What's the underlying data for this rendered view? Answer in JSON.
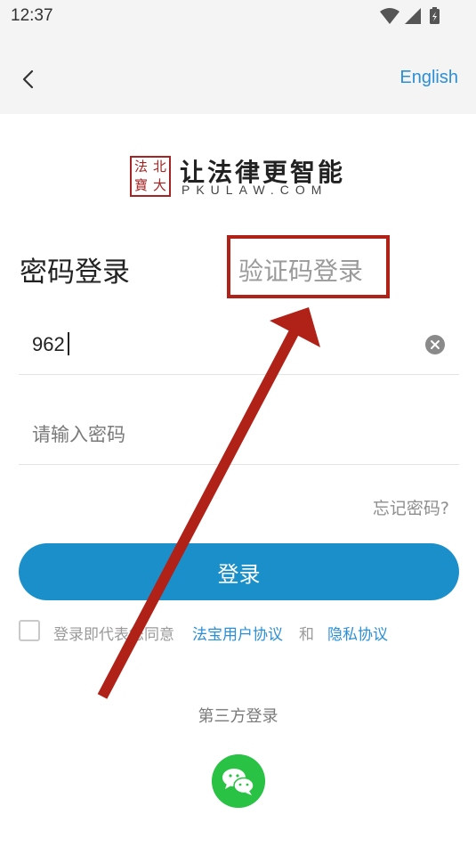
{
  "status_bar": {
    "time": "12:37"
  },
  "header": {
    "language_link": "English"
  },
  "logo": {
    "seal_chars": [
      "法",
      "北",
      "寶",
      "大"
    ],
    "title": "让法律更智能",
    "subtitle": "PKULAW.COM"
  },
  "tabs": {
    "password_login": "密码登录",
    "code_login": "验证码登录"
  },
  "form": {
    "phone_value": "962",
    "password_placeholder": "请输入密码",
    "forgot_password": "忘记密码?",
    "login_button": "登录"
  },
  "agreement": {
    "prefix": "登录即代表您同意",
    "user_agreement": "法宝用户协议",
    "and": "和",
    "privacy": "隐私协议"
  },
  "third_party": {
    "label": "第三方登录"
  },
  "colors": {
    "accent": "#1b8fca",
    "link": "#2b8fd6",
    "annotation": "#b02118",
    "wechat": "#29c244"
  }
}
